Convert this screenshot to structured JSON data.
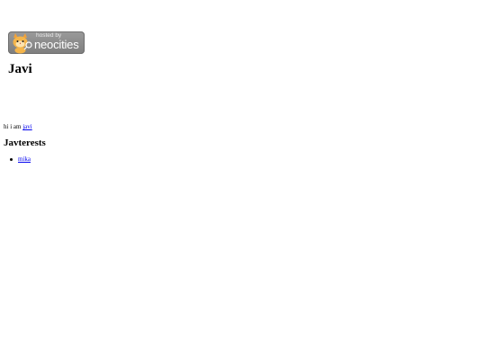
{
  "badge": {
    "hosted_text": "hosted by",
    "brand_text": "neocities"
  },
  "heading": {
    "title": "Javi"
  },
  "intro": {
    "prefix": "hi i am ",
    "link_text": "javi"
  },
  "interests": {
    "title": "Javterests",
    "items": [
      {
        "label": "mika"
      }
    ]
  }
}
